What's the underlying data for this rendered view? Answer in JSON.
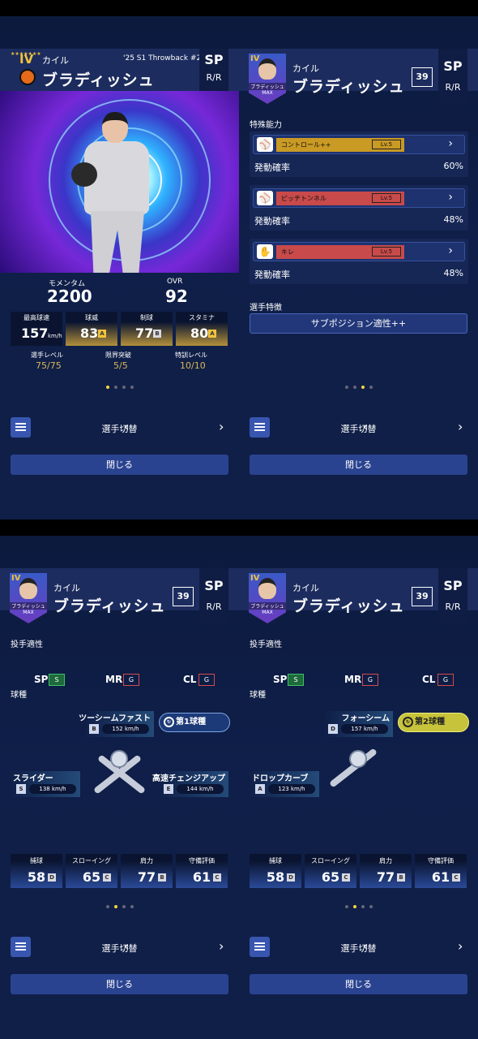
{
  "player": {
    "first_name": "カイル",
    "last_name": "ブラディッシュ",
    "rank": "IV",
    "series": "'25 S1 Throwback #2",
    "position": "SP",
    "throws_bats": "R/R",
    "level_badge": "39",
    "card_name": "ブラディッシュ",
    "card_max": "MAX"
  },
  "basic": {
    "momentum_label": "モメンタム",
    "momentum_value": "2200",
    "ovr_label": "OVR",
    "ovr_value": "92",
    "stats": [
      {
        "label": "最高球速",
        "value": "157",
        "unit": "km/h"
      },
      {
        "label": "球威",
        "value": "83",
        "grade": "A"
      },
      {
        "label": "制球",
        "value": "77",
        "grade": "B"
      },
      {
        "label": "スタミナ",
        "value": "80",
        "grade": "A"
      }
    ],
    "levels": [
      {
        "label": "選手レベル",
        "value": "75/75"
      },
      {
        "label": "限界突破",
        "value": "5/5"
      },
      {
        "label": "特訓レベル",
        "value": "10/10"
      }
    ]
  },
  "abilities": {
    "title": "特殊能力",
    "rate_label": "発動確率",
    "items": [
      {
        "name": "コントロール++",
        "level": "Lv.5",
        "rate": "60%",
        "color": "#c99a24"
      },
      {
        "name": "ピッチトンネル",
        "level": "Lv.5",
        "rate": "48%",
        "color": "#c84a4a"
      },
      {
        "name": "キレ",
        "level": "Lv.5",
        "rate": "48%",
        "color": "#c84a4a"
      }
    ],
    "trait_title": "選手特徴",
    "trait_value": "サブポジション適性++"
  },
  "aptitude": {
    "title": "投手適性",
    "items": [
      {
        "pos": "SP",
        "grade": "S"
      },
      {
        "pos": "MR",
        "grade": "G"
      },
      {
        "pos": "CL",
        "grade": "G"
      }
    ],
    "pitch_title": "球種"
  },
  "pitches_1": {
    "main": {
      "name": "ツーシームファスト",
      "grade": "B",
      "speed": "152 km/h"
    },
    "slot": "第1球種",
    "left": {
      "name": "スライダー",
      "grade": "S",
      "speed": "138 km/h"
    },
    "right": {
      "name": "高速チェンジアップ",
      "grade": "E",
      "speed": "144 km/h"
    }
  },
  "pitches_2": {
    "main": {
      "name": "フォーシーム",
      "grade": "D",
      "speed": "157 km/h"
    },
    "slot": "第2球種",
    "left": {
      "name": "ドロップカーブ",
      "grade": "A",
      "speed": "123 km/h"
    }
  },
  "fielding": [
    {
      "label": "捕球",
      "value": "58",
      "grade": "D"
    },
    {
      "label": "スローイング",
      "value": "65",
      "grade": "C"
    },
    {
      "label": "肩力",
      "value": "77",
      "grade": "B"
    },
    {
      "label": "守備評価",
      "value": "61",
      "grade": "C"
    }
  ],
  "nav": {
    "switch_label": "選手切替",
    "prev": "‹",
    "next": "›",
    "close_label": "閉じる"
  },
  "colors": {
    "gold": "#f0c33c",
    "grade_S": "#3fbf6a",
    "grade_G": "#d34b4b",
    "slot1": "#1d3a78",
    "slot2": "#c7c33a"
  }
}
